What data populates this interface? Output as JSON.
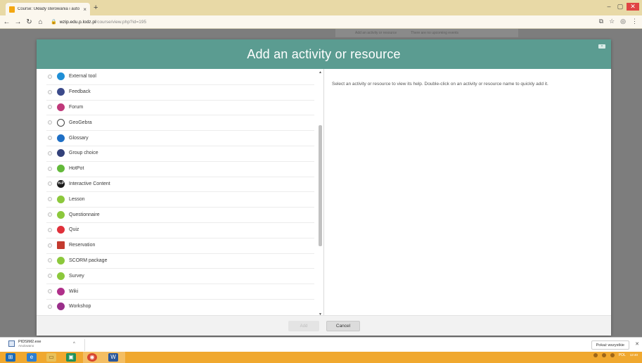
{
  "browser": {
    "tab_title": "Course: Układy sterowania i auto",
    "tab_close": "×",
    "new_tab": "+",
    "url_host": "wzip.edu.p.lodz.pl",
    "url_path": "/course/view.php?id=195",
    "window_controls": [
      "–",
      "▢",
      "✕"
    ],
    "nav_icons": [
      "arrow-left-icon",
      "arrow-right-icon",
      "reload-icon",
      "home-icon"
    ]
  },
  "background_page": {
    "strip_left": "Add an activity or resource",
    "strip_right": "There are no upcoming events"
  },
  "modal": {
    "title": "Add an activity or resource",
    "help_text": "Select an activity or resource to view its help. Double-click on an activity or resource name to quickly add it.",
    "activities": [
      {
        "label": "External tool",
        "icon": "puzzle-icon",
        "color": "#1f8fd6",
        "glyph": ""
      },
      {
        "label": "Feedback",
        "icon": "megaphone-icon",
        "color": "#3b4a8a",
        "glyph": ""
      },
      {
        "label": "Forum",
        "icon": "forum-icon",
        "color": "#c0397a",
        "glyph": ""
      },
      {
        "label": "GeoGebra",
        "icon": "geogebra-icon",
        "color": "#444444",
        "glyph": "",
        "ring": true
      },
      {
        "label": "Glossary",
        "icon": "glossary-icon",
        "color": "#1e6fc5",
        "glyph": ""
      },
      {
        "label": "Group choice",
        "icon": "group-choice-icon",
        "color": "#33417a",
        "glyph": ""
      },
      {
        "label": "HotPot",
        "icon": "hotpot-icon",
        "color": "#63b93a",
        "glyph": ""
      },
      {
        "label": "Interactive Content",
        "icon": "h5p-icon",
        "color": "#1a1a1a",
        "glyph": "H-P"
      },
      {
        "label": "Lesson",
        "icon": "lesson-icon",
        "color": "#8cc83c",
        "glyph": ""
      },
      {
        "label": "Questionnaire",
        "icon": "questionnaire-icon",
        "color": "#8cc83c",
        "glyph": ""
      },
      {
        "label": "Quiz",
        "icon": "quiz-icon",
        "color": "#e0303a",
        "glyph": ""
      },
      {
        "label": "Reservation",
        "icon": "calendar-icon",
        "color": "#c33a2e",
        "glyph": "",
        "square": true
      },
      {
        "label": "SCORM package",
        "icon": "scorm-icon",
        "color": "#8cc83c",
        "glyph": ""
      },
      {
        "label": "Survey",
        "icon": "survey-icon",
        "color": "#8cc83c",
        "glyph": ""
      },
      {
        "label": "Wiki",
        "icon": "wiki-icon",
        "color": "#b0308a",
        "glyph": ""
      },
      {
        "label": "Workshop",
        "icon": "workshop-icon",
        "color": "#9a2f8a",
        "glyph": ""
      }
    ],
    "add_button": "Add",
    "cancel_button": "Cancel"
  },
  "downloads": {
    "file_name": "PIDSIM2.exe",
    "file_status": "Anulowano",
    "show_all": "Pokaż wszystkie"
  },
  "taskbar": {
    "tray_lang": "POL",
    "clock_time": "12:40"
  }
}
